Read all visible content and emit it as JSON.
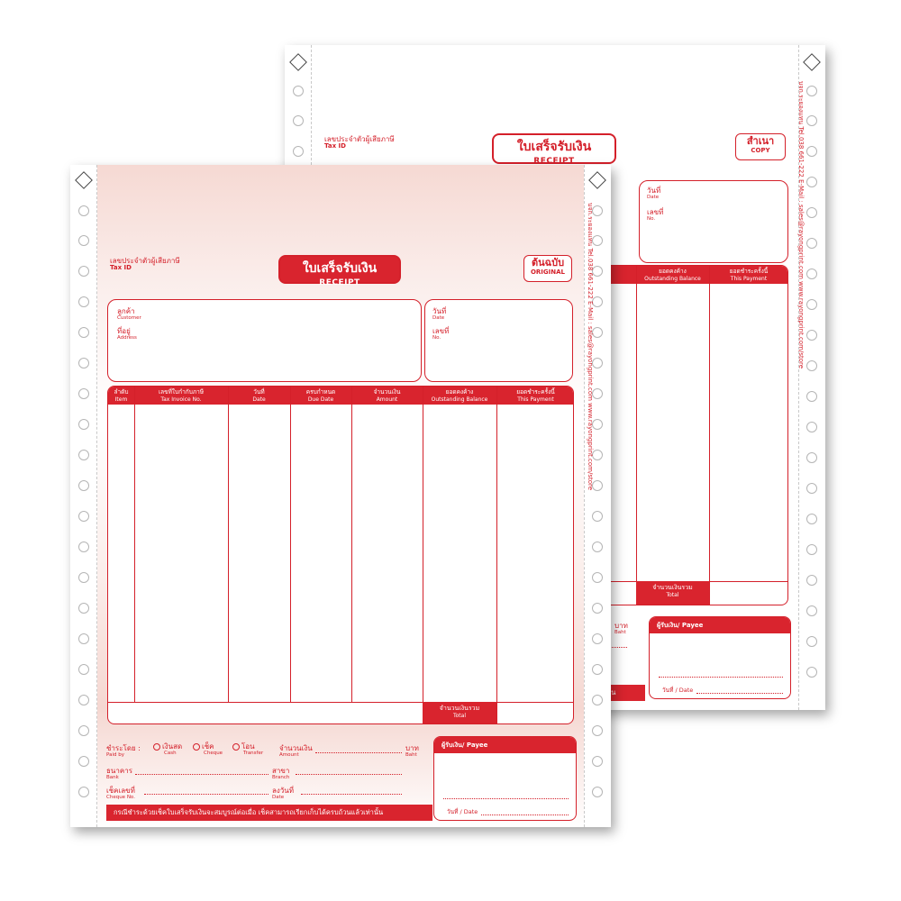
{
  "form": {
    "title_th": "ใบเสร็จรับเงิน",
    "title_en": "RECEIPT",
    "tax_id_th": "เลขประจำตัวผู้เสียภาษี",
    "tax_id_en": "Tax ID",
    "original_th": "ต้นฉบับ",
    "original_en": "ORIGINAL",
    "copy_th": "สำเนา",
    "copy_en": "COPY",
    "customer_th": "ลูกค้า",
    "customer_en": "Customer",
    "address_th": "ที่อยู่",
    "address_en": "Address",
    "date_th": "วันที่",
    "date_en": "Date",
    "no_th": "เลขที่",
    "no_en": "No.",
    "side_text": "บจก.ระยองแทน  Tel.038 661-222  E-Mail : sales@rayongprint.com  www.rayongprint.com/store"
  },
  "columns": [
    {
      "th": "ลำดับ",
      "en": "Item"
    },
    {
      "th": "เลขที่ใบกำกับภาษี",
      "en": "Tax Invoice No."
    },
    {
      "th": "วันที่",
      "en": "Date"
    },
    {
      "th": "ครบกำหนด",
      "en": "Due Date"
    },
    {
      "th": "จำนวนเงิน",
      "en": "Amount"
    },
    {
      "th": "ยอดคงค้าง",
      "en": "Outstanding Balance"
    },
    {
      "th": "ยอดชำระครั้งนี้",
      "en": "This Payment"
    }
  ],
  "total": {
    "th": "จำนวนเงินรวม",
    "en": "Total"
  },
  "payment": {
    "paid_by_th": "ชำระโดย :",
    "paid_by_en": "Paid by",
    "cash_th": "เงินสด",
    "cash_en": "Cash",
    "cheque_th": "เช็ค",
    "cheque_en": "Cheque",
    "transfer_th": "โอน",
    "transfer_en": "Transfer",
    "amount_th": "จำนวนเงิน",
    "amount_en": "Amount",
    "baht_th": "บาท",
    "baht_en": "Baht",
    "bank_th": "ธนาคาร",
    "bank_en": "Bank",
    "branch_th": "สาขา",
    "branch_en": "Branch",
    "cheque_no_th": "เช็คเลขที่",
    "cheque_no_en": "Cheque No.",
    "dated_th": "ลงวันที่",
    "dated_en": "Date"
  },
  "payee": {
    "label": "ผู้รับเงิน/ Payee",
    "date_label": "วันที่ / Date"
  },
  "footer": {
    "note": "กรณีชำระด้วยเช็คใบเสร็จรับเงินจะสมบูรณ์ต่อเมื่อ เช็คสามารถเรียกเก็บได้ครบถ้วนแล้วเท่านั้น",
    "note_copy_tail": "ท่านั้น"
  },
  "colors": {
    "brand_red": "#d9242e"
  }
}
